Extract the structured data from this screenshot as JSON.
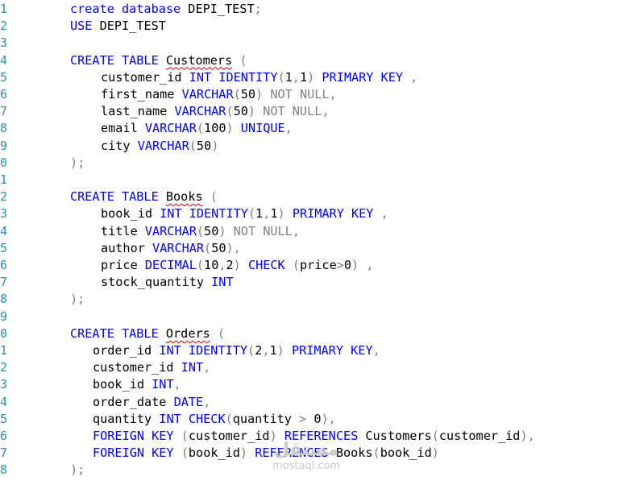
{
  "colors": {
    "keyword": "#0000ff",
    "gray": "#808080",
    "text": "#000000",
    "line_number": "#2b91af",
    "squiggle": "#e00000"
  },
  "line_numbers": [
    "1",
    "2",
    "3",
    "4",
    "5",
    "6",
    "7",
    "8",
    "9",
    "0",
    "1",
    "2",
    "3",
    "4",
    "5",
    "6",
    "7",
    "8",
    "9",
    "0",
    "1",
    "2",
    "3",
    "4",
    "5",
    "6",
    "7",
    "8"
  ],
  "lines": [
    {
      "indent": 87,
      "tokens": [
        {
          "t": "create database",
          "c": "kw"
        },
        {
          "t": " DEPI_TEST"
        },
        {
          "t": ";",
          "c": "gr"
        }
      ]
    },
    {
      "indent": 87,
      "tokens": [
        {
          "t": "USE",
          "c": "kw"
        },
        {
          "t": " DEPI_TEST"
        }
      ]
    },
    {
      "indent": 87,
      "tokens": []
    },
    {
      "indent": 87,
      "tokens": [
        {
          "t": "CREATE TABLE",
          "c": "kw"
        },
        {
          "t": " "
        },
        {
          "t": "Customers",
          "c": "sq"
        },
        {
          "t": " "
        },
        {
          "t": "(",
          "c": "gr"
        }
      ]
    },
    {
      "indent": 125,
      "tokens": [
        {
          "t": "customer_id "
        },
        {
          "t": "INT IDENTITY",
          "c": "kw"
        },
        {
          "t": "(",
          "c": "gr"
        },
        {
          "t": "1"
        },
        {
          "t": ",",
          "c": "gr"
        },
        {
          "t": "1"
        },
        {
          "t": ")",
          "c": "gr"
        },
        {
          "t": " "
        },
        {
          "t": "PRIMARY KEY",
          "c": "kw"
        },
        {
          "t": " "
        },
        {
          "t": ",",
          "c": "gr"
        }
      ]
    },
    {
      "indent": 125,
      "tokens": [
        {
          "t": "first_name "
        },
        {
          "t": "VARCHAR",
          "c": "kw"
        },
        {
          "t": "(",
          "c": "gr"
        },
        {
          "t": "50"
        },
        {
          "t": ")",
          "c": "gr"
        },
        {
          "t": " "
        },
        {
          "t": "NOT NULL",
          "c": "gr"
        },
        {
          "t": ",",
          "c": "gr"
        }
      ]
    },
    {
      "indent": 125,
      "tokens": [
        {
          "t": "last_name "
        },
        {
          "t": "VARCHAR",
          "c": "kw"
        },
        {
          "t": "(",
          "c": "gr"
        },
        {
          "t": "50"
        },
        {
          "t": ")",
          "c": "gr"
        },
        {
          "t": " "
        },
        {
          "t": "NOT NULL",
          "c": "gr"
        },
        {
          "t": ",",
          "c": "gr"
        }
      ]
    },
    {
      "indent": 125,
      "tokens": [
        {
          "t": "email "
        },
        {
          "t": "VARCHAR",
          "c": "kw"
        },
        {
          "t": "(",
          "c": "gr"
        },
        {
          "t": "100"
        },
        {
          "t": ")",
          "c": "gr"
        },
        {
          "t": " "
        },
        {
          "t": "UNIQUE",
          "c": "kw"
        },
        {
          "t": ",",
          "c": "gr"
        }
      ]
    },
    {
      "indent": 125,
      "tokens": [
        {
          "t": "city "
        },
        {
          "t": "VARCHAR",
          "c": "kw"
        },
        {
          "t": "(",
          "c": "gr"
        },
        {
          "t": "50"
        },
        {
          "t": ")",
          "c": "gr"
        }
      ]
    },
    {
      "indent": 87,
      "tokens": [
        {
          "t": ");",
          "c": "gr"
        }
      ]
    },
    {
      "indent": 87,
      "tokens": []
    },
    {
      "indent": 87,
      "tokens": [
        {
          "t": "CREATE TABLE",
          "c": "kw"
        },
        {
          "t": " "
        },
        {
          "t": "Books",
          "c": "sq"
        },
        {
          "t": " "
        },
        {
          "t": "(",
          "c": "gr"
        }
      ]
    },
    {
      "indent": 125,
      "tokens": [
        {
          "t": "book_id "
        },
        {
          "t": "INT IDENTITY",
          "c": "kw"
        },
        {
          "t": "(",
          "c": "gr"
        },
        {
          "t": "1"
        },
        {
          "t": ",",
          "c": "gr"
        },
        {
          "t": "1"
        },
        {
          "t": ")",
          "c": "gr"
        },
        {
          "t": " "
        },
        {
          "t": "PRIMARY KEY",
          "c": "kw"
        },
        {
          "t": " "
        },
        {
          "t": ",",
          "c": "gr"
        }
      ]
    },
    {
      "indent": 125,
      "tokens": [
        {
          "t": "title "
        },
        {
          "t": "VARCHAR",
          "c": "kw"
        },
        {
          "t": "(",
          "c": "gr"
        },
        {
          "t": "50"
        },
        {
          "t": ")",
          "c": "gr"
        },
        {
          "t": " "
        },
        {
          "t": "NOT NULL",
          "c": "gr"
        },
        {
          "t": ",",
          "c": "gr"
        }
      ]
    },
    {
      "indent": 125,
      "tokens": [
        {
          "t": "author "
        },
        {
          "t": "VARCHAR",
          "c": "kw"
        },
        {
          "t": "(",
          "c": "gr"
        },
        {
          "t": "50"
        },
        {
          "t": "),",
          "c": "gr"
        }
      ]
    },
    {
      "indent": 125,
      "tokens": [
        {
          "t": "price "
        },
        {
          "t": "DECIMAL",
          "c": "kw"
        },
        {
          "t": "(",
          "c": "gr"
        },
        {
          "t": "10"
        },
        {
          "t": ",",
          "c": "gr"
        },
        {
          "t": "2"
        },
        {
          "t": ")",
          "c": "gr"
        },
        {
          "t": " "
        },
        {
          "t": "CHECK",
          "c": "kw"
        },
        {
          "t": " "
        },
        {
          "t": "(",
          "c": "gr"
        },
        {
          "t": "price"
        },
        {
          "t": ">",
          "c": "gr"
        },
        {
          "t": "0"
        },
        {
          "t": ")",
          "c": "gr"
        },
        {
          "t": " "
        },
        {
          "t": ",",
          "c": "gr"
        }
      ]
    },
    {
      "indent": 125,
      "tokens": [
        {
          "t": "stock_quantity "
        },
        {
          "t": "INT",
          "c": "kw"
        }
      ]
    },
    {
      "indent": 87,
      "tokens": [
        {
          "t": ");",
          "c": "gr"
        }
      ]
    },
    {
      "indent": 87,
      "tokens": []
    },
    {
      "indent": 87,
      "tokens": [
        {
          "t": "CREATE TABLE",
          "c": "kw"
        },
        {
          "t": " "
        },
        {
          "t": "Orders",
          "c": "sq"
        },
        {
          "t": " "
        },
        {
          "t": "(",
          "c": "gr"
        }
      ]
    },
    {
      "indent": 115,
      "tokens": [
        {
          "t": "order_id "
        },
        {
          "t": "INT IDENTITY",
          "c": "kw"
        },
        {
          "t": "(",
          "c": "gr"
        },
        {
          "t": "2"
        },
        {
          "t": ",",
          "c": "gr"
        },
        {
          "t": "1"
        },
        {
          "t": ")",
          "c": "gr"
        },
        {
          "t": " "
        },
        {
          "t": "PRIMARY KEY",
          "c": "kw"
        },
        {
          "t": ",",
          "c": "gr"
        }
      ]
    },
    {
      "indent": 115,
      "tokens": [
        {
          "t": "customer_id "
        },
        {
          "t": "INT",
          "c": "kw"
        },
        {
          "t": ",",
          "c": "gr"
        }
      ]
    },
    {
      "indent": 115,
      "tokens": [
        {
          "t": "book_id "
        },
        {
          "t": "INT",
          "c": "kw"
        },
        {
          "t": ",",
          "c": "gr"
        }
      ]
    },
    {
      "indent": 115,
      "tokens": [
        {
          "t": "order_date "
        },
        {
          "t": "DATE",
          "c": "kw"
        },
        {
          "t": ",",
          "c": "gr"
        }
      ]
    },
    {
      "indent": 115,
      "tokens": [
        {
          "t": "quantity "
        },
        {
          "t": "INT CHECK",
          "c": "kw"
        },
        {
          "t": "(",
          "c": "gr"
        },
        {
          "t": "quantity "
        },
        {
          "t": ">",
          "c": "gr"
        },
        {
          "t": " 0"
        },
        {
          "t": "),",
          "c": "gr"
        }
      ]
    },
    {
      "indent": 115,
      "tokens": [
        {
          "t": "FOREIGN KEY",
          "c": "kw"
        },
        {
          "t": " "
        },
        {
          "t": "(",
          "c": "gr"
        },
        {
          "t": "customer_id"
        },
        {
          "t": ")",
          "c": "gr"
        },
        {
          "t": " "
        },
        {
          "t": "REFERENCES",
          "c": "kw"
        },
        {
          "t": " Customers"
        },
        {
          "t": "(",
          "c": "gr"
        },
        {
          "t": "customer_id"
        },
        {
          "t": "),",
          "c": "gr"
        }
      ]
    },
    {
      "indent": 115,
      "tokens": [
        {
          "t": "FOREIGN KEY",
          "c": "kw"
        },
        {
          "t": " "
        },
        {
          "t": "(",
          "c": "gr"
        },
        {
          "t": "book_id"
        },
        {
          "t": ")",
          "c": "gr"
        },
        {
          "t": " "
        },
        {
          "t": "REFERENCES",
          "c": "kw"
        },
        {
          "t": " Books"
        },
        {
          "t": "(",
          "c": "gr"
        },
        {
          "t": "book_id"
        },
        {
          "t": ")",
          "c": "gr"
        }
      ]
    },
    {
      "indent": 87,
      "tokens": [
        {
          "t": ");",
          "c": "gr"
        }
      ]
    }
  ],
  "watermark": {
    "logo": "مستقل",
    "text": "mostaql.com"
  }
}
